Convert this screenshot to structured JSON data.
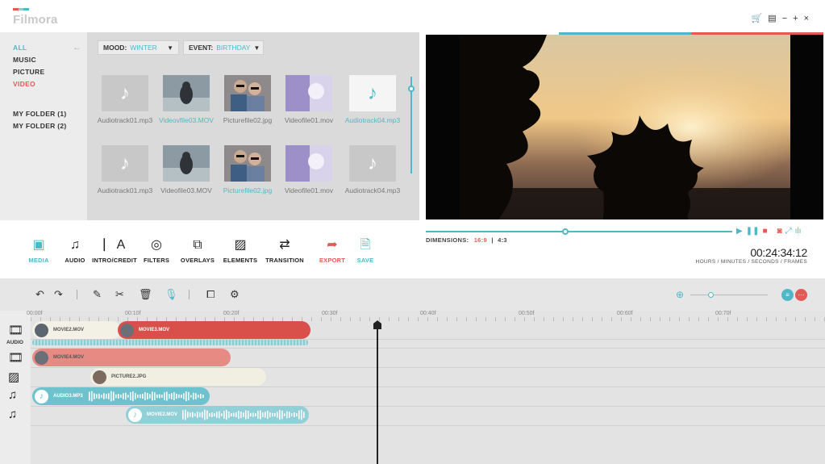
{
  "app": {
    "name": "Filmora",
    "brand_colors": [
      "#e35a55",
      "#4fb8c6",
      "#9ac6ce"
    ]
  },
  "window_controls": [
    {
      "name": "cart-icon",
      "glyph": "🛒"
    },
    {
      "name": "menu-icon",
      "glyph": "▤"
    },
    {
      "name": "minimize-icon",
      "glyph": "−"
    },
    {
      "name": "maximize-icon",
      "glyph": "+"
    },
    {
      "name": "close-icon",
      "glyph": "×"
    }
  ],
  "sidebar": {
    "categories": [
      {
        "label": "ALL",
        "color": "#4fb8c6"
      },
      {
        "label": "MUSIC",
        "color": "#333333"
      },
      {
        "label": "PICTURE",
        "color": "#333333"
      },
      {
        "label": "VIDEO",
        "color": "#e35a55"
      }
    ],
    "folders": [
      "MY FOLDER (1)",
      "MY FOLDER (2)"
    ]
  },
  "filters": {
    "mood_label": "MOOD:",
    "mood_value": "WINTER",
    "event_label": "EVENT:",
    "event_value": "BIRTHDAY"
  },
  "media_items": [
    {
      "label": "Audiotrack01.mp3",
      "type": "audio",
      "selected": false
    },
    {
      "label": "Videovfile03.MOV",
      "type": "video-person",
      "selected": true
    },
    {
      "label": "Picturefile02.jpg",
      "type": "photo-girls",
      "selected": false
    },
    {
      "label": "Videofile01.mov",
      "type": "video-purple",
      "selected": false
    },
    {
      "label": "Audiotrack04.mp3",
      "type": "audio",
      "selected": true
    },
    {
      "label": "Audiotrack01.mp3",
      "type": "audio",
      "selected": false
    },
    {
      "label": "Videofile03.MOV",
      "type": "video-person",
      "selected": false
    },
    {
      "label": "Picturefile02.jpg",
      "type": "photo-girls",
      "selected": true
    },
    {
      "label": "Videofile01.mov",
      "type": "video-purple",
      "selected": false
    },
    {
      "label": "Audiotrack04.mp3",
      "type": "audio",
      "selected": false
    }
  ],
  "tools": [
    {
      "label": "MEDIA",
      "icon": "media-icon",
      "glyph": "▣",
      "color": "#4fb8c6"
    },
    {
      "label": "AUDIO",
      "icon": "music-note-icon",
      "glyph": "♫",
      "color": "#222222"
    },
    {
      "label": "INTRO/CREDIT",
      "icon": "text-icon",
      "glyph": "⎸A",
      "color": "#222222"
    },
    {
      "label": "FILTERS",
      "icon": "filters-icon",
      "glyph": "◎",
      "color": "#222222"
    },
    {
      "label": "OVERLAYS",
      "icon": "overlays-icon",
      "glyph": "⧉",
      "color": "#222222"
    },
    {
      "label": "ELEMENTS",
      "icon": "image-icon",
      "glyph": "▨",
      "color": "#222222"
    },
    {
      "label": "TRANSITION",
      "icon": "transition-icon",
      "glyph": "⇄",
      "color": "#222222"
    },
    {
      "label": "EXPORT",
      "icon": "export-arrow-icon",
      "glyph": "➦",
      "color": "#e35a55"
    },
    {
      "label": "SAVE",
      "icon": "save-icon",
      "glyph": "🗎",
      "color": "#4fb8c6"
    }
  ],
  "preview": {
    "dimensions_label": "DIMENSIONS:",
    "ratio_selected": "16:9",
    "separator": "|",
    "ratio_other": "4:3",
    "timecode": "00:24:34:12",
    "timecode_caption": "HOURS / MINUTES / SECONDS / FRAMES"
  },
  "timeline": {
    "tools": [
      {
        "name": "undo-icon",
        "glyph": "↶"
      },
      {
        "name": "redo-icon",
        "glyph": "↷"
      },
      {
        "name": "pencil-icon",
        "glyph": "✎"
      },
      {
        "name": "split-icon",
        "glyph": "✂"
      },
      {
        "name": "trash-icon",
        "glyph": "🗑"
      },
      {
        "name": "microphone-icon",
        "glyph": "🎙"
      },
      {
        "name": "screen-record-icon",
        "glyph": "⧠"
      },
      {
        "name": "settings-card-icon",
        "glyph": "⚙"
      }
    ],
    "ruler": [
      "00:00f",
      "00:10f",
      "00:20f",
      "00:30f",
      "00:40f",
      "00:50f",
      "00:60f",
      "00:70f"
    ],
    "track_audio_label": "AUDIO",
    "clips": {
      "v1_a": "MOVIE2.MOV",
      "v1_b": "MOVIE3.MOV",
      "v2": "MOVIE4.MOV",
      "pic": "PICTURE2.JPG",
      "a1": "AUDIO3.MP3",
      "a2": "MOVIE2.MOV"
    }
  }
}
